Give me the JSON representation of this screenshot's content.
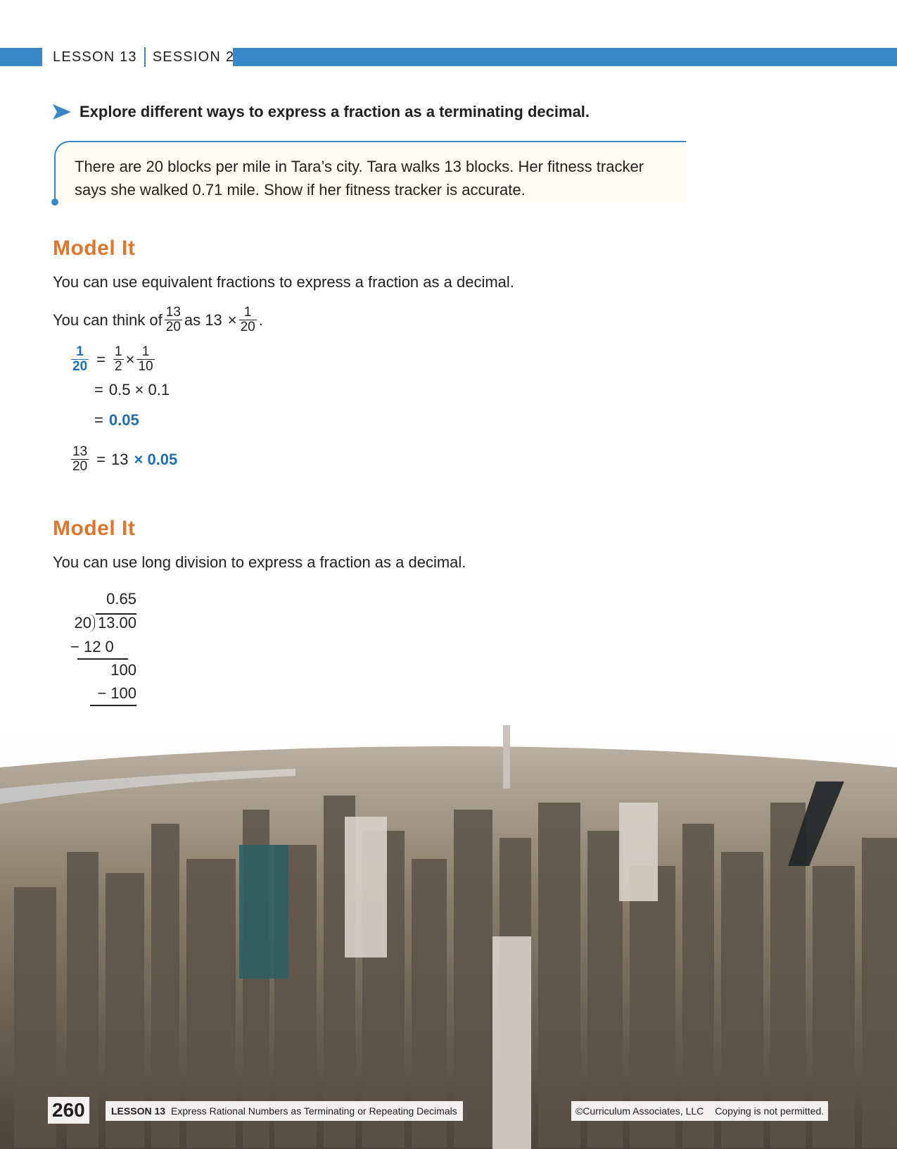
{
  "header": {
    "lesson": "LESSON 13",
    "session": "SESSION 2"
  },
  "explore": {
    "text": "Explore different ways to express a fraction as a terminating decimal."
  },
  "problem": {
    "line1": "There are 20 blocks per mile in Tara’s city. Tara walks 13 blocks. Her fitness tracker",
    "line2": "says she walked 0.71 mile. Show if her fitness tracker is accurate."
  },
  "model1": {
    "heading": "Model It",
    "intro": "You can use equivalent fractions to express a fraction as a decimal.",
    "think_pre": "You can think of",
    "think_mid": "as 13",
    "times": "×",
    "period": ".",
    "frac_13": "13",
    "frac_20": "20",
    "frac_1": "1",
    "frac_2": "2",
    "frac_10": "10",
    "eq": "=",
    "step2": "0.5 × 0.1",
    "step3": "0.05",
    "final_13": "13",
    "final_times": "× 0.05"
  },
  "model2": {
    "heading": "Model It",
    "intro": "You can use long division to express a fraction as a decimal.",
    "quotient": "0.65",
    "divisor": "20",
    "dividend": "13.00",
    "sub1": "− 12 0",
    "rem1": "100",
    "sub2": "− 100"
  },
  "footer": {
    "page": "260",
    "lesson_label": "LESSON 13",
    "lesson_title": "Express Rational Numbers as Terminating or Repeating Decimals",
    "copyright": "©Curriculum Associates, LLC",
    "notice": "Copying is not permitted."
  },
  "colors": {
    "header_blue": "#3a87c8",
    "heading_orange": "#e0762b",
    "math_blue": "#1f6fb5"
  }
}
